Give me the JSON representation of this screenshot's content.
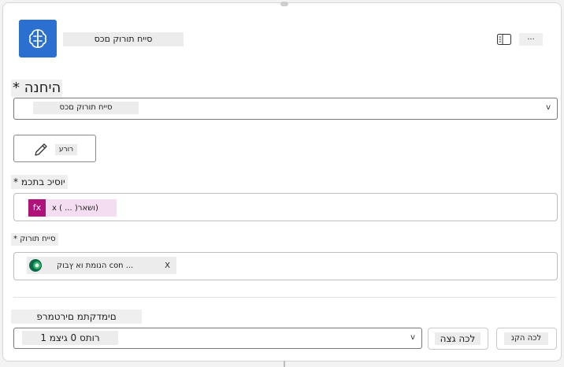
{
  "header": {
    "title": "סייח תורוק םכס",
    "app_icon": "brain-circuit-icon",
    "more_label": "...",
    "panel_icon": "side-panel-icon",
    "accent": "#2b6fd0"
  },
  "instructions": {
    "label": "* היחנה",
    "selected": "סייח תורוק םכס",
    "chevron": "v"
  },
  "edit": {
    "label": "רורע",
    "icon": "pencil-icon"
  },
  "content_input": {
    "label": "* יוסיכ בתכמ",
    "fx_badge": "fx",
    "fx_text": "x ( ... )ושאר)"
  },
  "data_source": {
    "label": "* סייח תורוק",
    "tag_text": "הנומת וא ץבוק con ...",
    "remove": "X",
    "icon": "dataverse-icon"
  },
  "params": {
    "label": "םימדקתמ םירטמרפ",
    "page_select": "1 רותס 0 גיצמ",
    "chevron": "v",
    "btn_show": "לכה גצה",
    "btn_hide": "לכה הקנ"
  }
}
